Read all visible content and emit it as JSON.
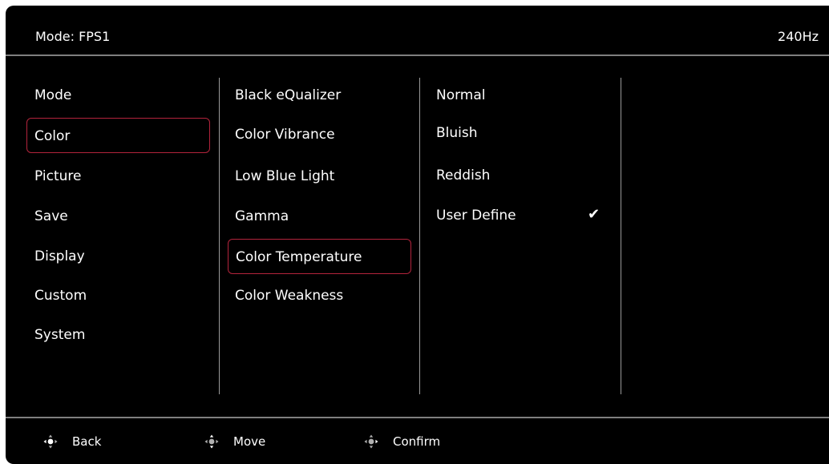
{
  "header": {
    "mode_label": "Mode: FPS1",
    "refresh_rate": "240Hz"
  },
  "menu_level1": {
    "items": [
      "Mode",
      "Color",
      "Picture",
      "Save",
      "Display",
      "Custom",
      "System"
    ],
    "selected": "Color"
  },
  "menu_level2": {
    "items": [
      "Black eQualizer",
      "Color Vibrance",
      "Low Blue Light",
      "Gamma",
      "Color Temperature",
      "Color Weakness"
    ],
    "selected": "Color Temperature"
  },
  "menu_level3": {
    "items": [
      "Normal",
      "Bluish",
      "Reddish",
      "User Define"
    ],
    "checked": "User Define",
    "check_icon": "checkmark-icon"
  },
  "footer": {
    "back_label": "Back",
    "move_label": "Move",
    "confirm_label": "Confirm",
    "icon": "dpad-icon"
  },
  "colors": {
    "background": "#000000",
    "text": "#ffffff",
    "highlight_border": "#b3243c",
    "divider": "#7f7f7f"
  }
}
